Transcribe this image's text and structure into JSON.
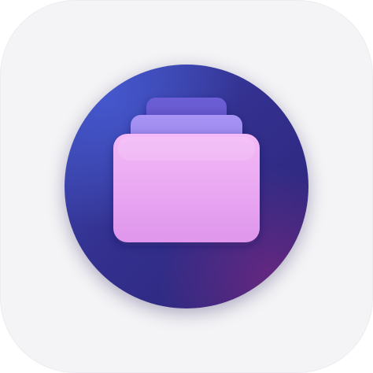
{
  "app_icon": {
    "name": "folder-stack-icon",
    "colors": {
      "tile_background": "#f4f4f6",
      "badge_gradient_top": "#3f4fb8",
      "badge_gradient_bottom": "#2b2577",
      "badge_glow": "#78288a",
      "back_card": "#6a5cd0",
      "middle_card": "#a08ef0",
      "front_folder_top": "#f3b8f6",
      "front_folder_bottom": "#e098ee"
    }
  }
}
